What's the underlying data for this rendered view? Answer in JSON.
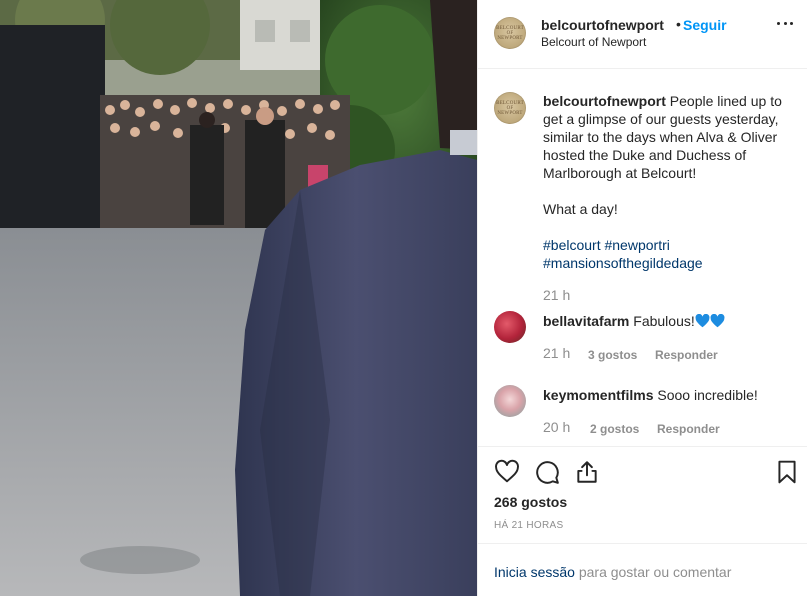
{
  "header": {
    "username": "belcourtofnewport",
    "separator": "•",
    "follow_label": "Seguir",
    "location": "Belcourt of Newport",
    "avatar_monogram": "BELCOURT OF NEWPORT",
    "more_icon": "more-horizontal-icon"
  },
  "caption": {
    "username": "belcourtofnewport",
    "text": "People lined up to get a glimpse of our guests yesterday, similar to the days when Alva & Oliver hosted the Duke and Duchess of Marlborough at Belcourt!",
    "line2": "What a day!",
    "hashtags": [
      "#belcourt",
      "#newportri",
      "#mansionsofthegildedage"
    ],
    "time": "21 h"
  },
  "comments": [
    {
      "username": "bellavitafarm",
      "text": "Fabulous!",
      "emoji": "blue-heart-emoji ×2",
      "time": "21 h",
      "likes": "3 gostos",
      "reply_label": "Responder"
    },
    {
      "username": "keymomentfilms",
      "text": "Sooo incredible!",
      "time": "20 h",
      "likes": "2 gostos",
      "reply_label": "Responder"
    }
  ],
  "actions": {
    "icons": [
      "heart-icon",
      "comment-icon",
      "share-icon",
      "bookmark-icon"
    ],
    "likes": "268 gostos",
    "posted_ago": "HÁ 21 HORAS"
  },
  "login": {
    "link_label": "Inicia sessão",
    "rest": "para gostar ou comentar"
  },
  "colors": {
    "link_blue": "#0095f6",
    "hashtag_blue": "#00376b",
    "muted_gray": "#8e8e8e",
    "border": "#efefef",
    "heart_emoji_blue": "#1d8ce0"
  }
}
